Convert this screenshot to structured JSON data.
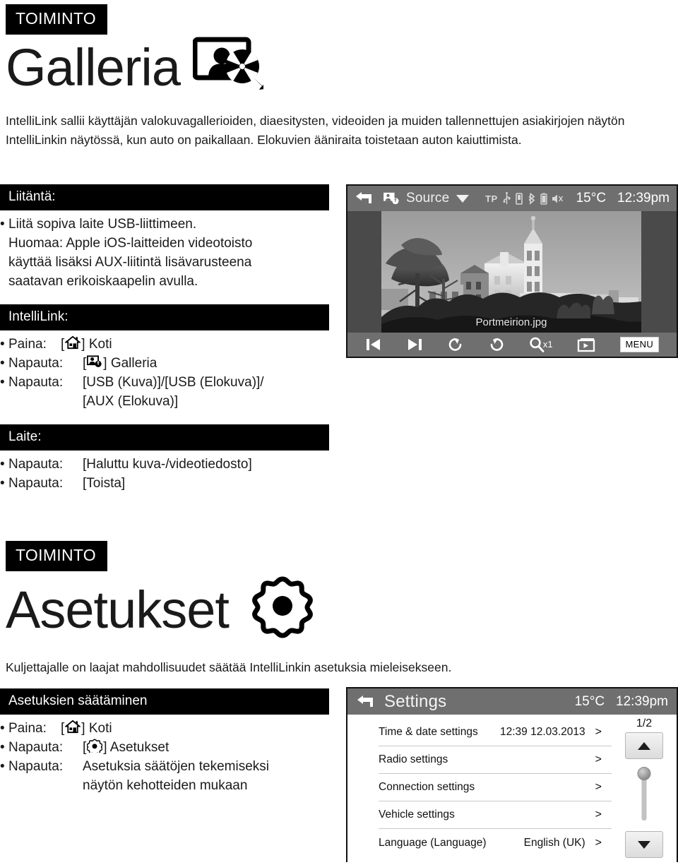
{
  "page": {
    "sections": [
      {
        "tag": "TOIMINTO",
        "title": "Galleria",
        "icon": "gallery-icon",
        "intro": "IntelliLink sallii käyttäjän valokuvagallerioiden, diaesitysten, videoiden ja muiden tallennettujen asiakirjojen näytön IntelliLinkin näytössä, kun auto on paikallaan. Elokuvien ääniraita toistetaan auton kaiuttimista.",
        "blocks": [
          {
            "heading": "Liitäntä:",
            "rows": [
              {
                "bullet": "•",
                "label": "",
                "value": "Liitä sopiva laite USB-liittimeen."
              },
              {
                "bullet": "",
                "label": "",
                "value": "Huomaa: Apple iOS-laitteiden videotoisto"
              },
              {
                "bullet": "",
                "label": "",
                "value": "käyttää lisäksi AUX-liitintä lisävarusteena"
              },
              {
                "bullet": "",
                "label": "",
                "value": "saatavan erikoiskaapelin avulla."
              }
            ]
          },
          {
            "heading": "IntelliLink:",
            "rows": [
              {
                "bullet": "•",
                "label": "Paina:",
                "icon": "home-icon",
                "value": "] Koti",
                "prefix": "["
              },
              {
                "bullet": "•",
                "label": "Napauta:",
                "icon": "gallery-icon",
                "value": "] Galleria",
                "prefix": "["
              },
              {
                "bullet": "•",
                "label": "Napauta:",
                "value": "[USB (Kuva)]/[USB (Elokuva)]/"
              },
              {
                "bullet": "",
                "label": "",
                "value": "[AUX (Elokuva)]"
              }
            ]
          },
          {
            "heading": "Laite:",
            "rows": [
              {
                "bullet": "•",
                "label": "Napauta:",
                "value": "[Haluttu kuva-/videotiedosto]"
              },
              {
                "bullet": "•",
                "label": "Napauta:",
                "value": "[Toista]"
              }
            ]
          }
        ]
      },
      {
        "tag": "TOIMINTO",
        "title": "Asetukset",
        "icon": "gear-icon",
        "intro": "Kuljettajalle on laajat mahdollisuudet säätää IntelliLinkin asetuksia mieleisekseen.",
        "blocks": [
          {
            "heading": "Asetuksien säätäminen",
            "rows": [
              {
                "bullet": "•",
                "label": "Paina:",
                "icon": "home-icon",
                "value": "] Koti",
                "prefix": "["
              },
              {
                "bullet": "•",
                "label": "Napauta:",
                "icon": "gear-icon",
                "value": "] Asetukset",
                "prefix": "["
              },
              {
                "bullet": "•",
                "label": "Napauta:",
                "value": "Asetuksia säätöjen tekemiseksi"
              },
              {
                "bullet": "",
                "label": "",
                "value": "näytön kehotteiden mukaan"
              }
            ]
          }
        ]
      }
    ]
  },
  "gallery_screen": {
    "topbar": {
      "back_icon": "back-arrow-icon",
      "source_icon": "gallery-icon",
      "source_label": "Source",
      "dropdown_icon": "chevron-down-icon",
      "status_icons": [
        "TP",
        "usb-icon",
        "phone-icon",
        "bluetooth-icon",
        "battery-icon",
        "mute-speaker-icon"
      ],
      "tp_label": "TP",
      "temperature": "15°C",
      "time": "12:39pm"
    },
    "photo": {
      "filename": "Portmeirion.jpg",
      "alt": "Portmeirion village with bell tower, grayscale"
    },
    "controls": [
      {
        "name": "previous-button",
        "icon": "skip-previous-icon",
        "label": ""
      },
      {
        "name": "next-button",
        "icon": "skip-next-icon",
        "label": ""
      },
      {
        "name": "rotate-left-button",
        "icon": "rotate-ccw-icon",
        "label": ""
      },
      {
        "name": "rotate-right-button",
        "icon": "rotate-cw-icon",
        "label": ""
      },
      {
        "name": "zoom-button",
        "icon": "magnifier-icon",
        "label": "x1"
      },
      {
        "name": "slideshow-button",
        "icon": "slideshow-icon",
        "label": ""
      },
      {
        "name": "menu-button",
        "icon": "",
        "label": "MENU"
      }
    ]
  },
  "settings_screen": {
    "topbar": {
      "back_icon": "back-arrow-icon",
      "title": "Settings",
      "temperature": "15°C",
      "time": "12:39pm"
    },
    "rows": [
      {
        "label": "Time & date settings",
        "value": "12:39  12.03.2013",
        "chevron": ">"
      },
      {
        "label": "Radio settings",
        "value": "",
        "chevron": ">"
      },
      {
        "label": "Connection settings",
        "value": "",
        "chevron": ">"
      },
      {
        "label": "Vehicle settings",
        "value": "",
        "chevron": ">"
      },
      {
        "label": "Language (Language)",
        "value": "English (UK)",
        "chevron": ">"
      }
    ],
    "scrollbar": {
      "page_indicator": "1/2",
      "up_icon": "triangle-up-icon",
      "down_icon": "triangle-down-icon"
    }
  },
  "colors": {
    "black": "#000000",
    "device_bar": "#6f6f6f",
    "device_stage": "#4a4a4a",
    "text": "#1a1a1a"
  }
}
